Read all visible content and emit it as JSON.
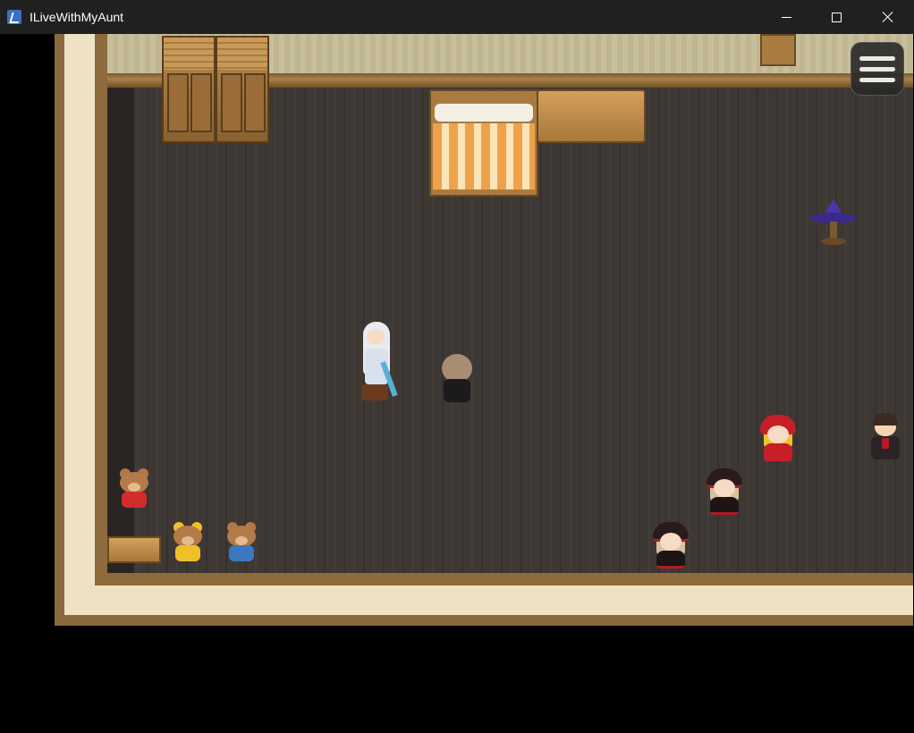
{
  "window": {
    "title": "ILiveWithMyAunt",
    "minimize_icon": "minimize-icon",
    "maximize_icon": "maximize-icon",
    "close_icon": "close-icon"
  },
  "game": {
    "menu_icon": "hamburger-menu-icon",
    "scene": "bedroom",
    "objects": [
      "wardrobe",
      "wardrobe",
      "bed",
      "bench",
      "chair",
      "witch-hat-stand",
      "small-bench"
    ],
    "characters": [
      "white-haired-swordswoman",
      "brown-haired-player"
    ],
    "dolls": [
      "bear-red",
      "bear-yellow",
      "bear-blue",
      "doll-red",
      "doll-dark",
      "doll-dark",
      "boy-doll"
    ]
  }
}
